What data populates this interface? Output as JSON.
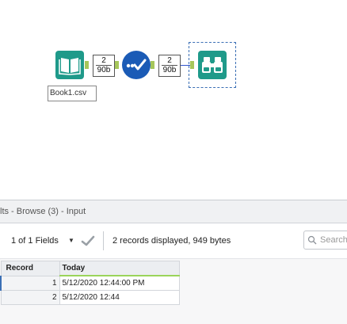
{
  "canvas": {
    "input_tool": {
      "label": "Book1.csv",
      "icon": "book-icon"
    },
    "connection_1": {
      "count": "2",
      "size": "90b"
    },
    "select_tool": {
      "icon": "check-flow-icon"
    },
    "connection_2": {
      "count": "2",
      "size": "90b"
    },
    "browse_tool": {
      "icon": "binoculars-icon"
    },
    "colors": {
      "tool_teal": "#1f9a8a",
      "select_blue": "#1b5bb6",
      "anchor_green": "#a6c65a"
    }
  },
  "results": {
    "title": "lts - Browse (3) - Input",
    "fields_label": "1 of 1 Fields",
    "records_info": "2 records displayed, 949 bytes",
    "search_placeholder": "Search",
    "columns": [
      "Record",
      "Today"
    ],
    "rows": [
      {
        "record": "1",
        "today": "5/12/2020 12:44:00 PM"
      },
      {
        "record": "2",
        "today": "5/12/2020 12:44"
      }
    ]
  }
}
